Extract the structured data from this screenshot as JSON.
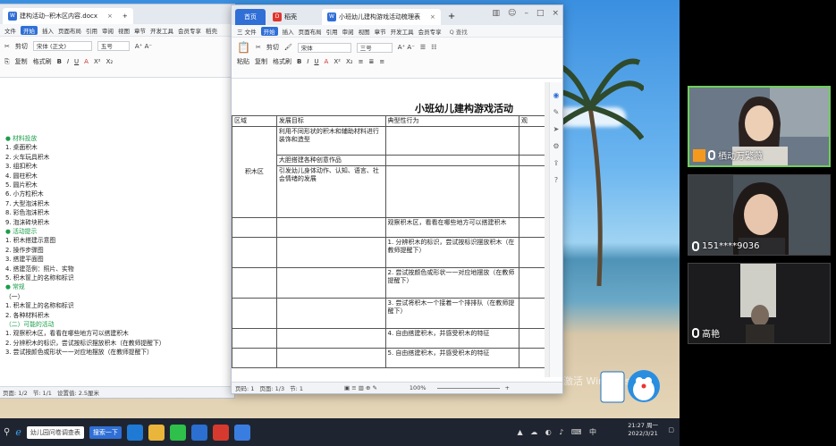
{
  "bg_window": {
    "tab_label": "建构活动--积木区内容.docx",
    "menu": [
      "文件",
      "开始",
      "插入",
      "页面布局",
      "引用",
      "审阅",
      "视图",
      "章节",
      "开发工具",
      "会员专享",
      "稻壳"
    ],
    "clipboard": {
      "cut": "剪切",
      "copy": "复制",
      "paste_format": "格式刷"
    },
    "font_name": "宋体 (正文)",
    "font_size": "五号",
    "lines": [
      {
        "text": "●   材料投放",
        "green": true
      },
      {
        "text": "1.  桌面积木",
        "green": false
      },
      {
        "text": "2.  火车玩具积木",
        "green": false
      },
      {
        "text": "3.  组扣积木",
        "green": false
      },
      {
        "text": "4.  圆柱积木",
        "green": false
      },
      {
        "text": "5.  圆片积木",
        "green": false
      },
      {
        "text": "6.  小方粒积木",
        "green": false
      },
      {
        "text": "7.  大型泡沫积木",
        "green": false
      },
      {
        "text": "8.  彩色泡沫积木",
        "green": false
      },
      {
        "text": "9.  泡沫砖块积木",
        "green": false
      },
      {
        "text": "●   活动提示",
        "green": true
      },
      {
        "text": "1.  积木搭建示意图",
        "green": false
      },
      {
        "text": "2.  操作步骤图",
        "green": false
      },
      {
        "text": "3.  搭建平面图",
        "green": false
      },
      {
        "text": "4.  搭建范例：照片、实物",
        "green": false
      },
      {
        "text": "5.  积木筐上的名称和标识",
        "green": false
      },
      {
        "text": "●   常规",
        "green": true
      },
      {
        "text": "（一）",
        "green": false
      },
      {
        "text": "1.  积木筐上的名称和标识",
        "green": false
      },
      {
        "text": "2.  各种材料积木",
        "green": false
      },
      {
        "text": "（二）可能的活动",
        "green": true
      },
      {
        "text": "1.  观察积木区，看看在哪些地方可以搭建积木",
        "green": false
      },
      {
        "text": "2.  分辨积木的标识，尝试按标识摆放积木（在教师提醒下）",
        "green": false
      },
      {
        "text": "3.  尝试按颜色或形状一一对应地摆放（在教师提醒下）",
        "green": false
      }
    ],
    "status": {
      "page": "页面: 1/2",
      "section": "节: 1/1",
      "setting": "设置值: 2.5厘米"
    }
  },
  "fg_window": {
    "tabs": [
      {
        "label": "首页",
        "icon_color": "#2f6fd6"
      },
      {
        "label": "稻壳",
        "icon_color": "#e0352b"
      },
      {
        "label": "小班幼儿建构游戏活动梳理表",
        "icon_color": "#2f6fd6"
      }
    ],
    "menu": [
      "三 文件",
      "开始",
      "插入",
      "页面布局",
      "引用",
      "审阅",
      "视图",
      "章节",
      "开发工具",
      "会员专享"
    ],
    "search_label": "Q 查找",
    "clipboard": {
      "paste": "粘贴",
      "cut": "剪切",
      "copy": "复制",
      "format": "格式刷"
    },
    "font_name": "宋体",
    "font_size": "三号",
    "doc_title": "小班幼儿建构游戏活动",
    "table_headers": [
      "区域",
      "发展目标",
      "典型性行为",
      "观"
    ],
    "area_name": "积木区",
    "goals": [
      "利用不同形状的积木和辅助材料进行装饰和造型",
      "大胆搭建各种创意作品",
      "引发幼儿身体动作、认知、语言、社会情绪的发展"
    ],
    "behaviors": [
      "观察积木区，看看在哪些地方可以搭建积木",
      "1. 分辨积木的标识，尝试按标识摆放积木（在教师提醒下）",
      "2. 尝试按颜色或形状一一对应地摆放（在教师提醒下）",
      "3. 尝试将积木一个接着一个排排队（在教师提醒下）",
      "4. 自由搭建积木，并感受积木的特征",
      "5. 自由搭建积木，并感受积木的特征"
    ],
    "status": {
      "words": "页码: 1",
      "page": "页面: 1/3",
      "section": "节: 1",
      "zoom": "100%"
    }
  },
  "participants": [
    {
      "name": "栖动万繁薇",
      "icon": "avatar-icon"
    },
    {
      "name": "151****9036",
      "icon": "mic-icon"
    },
    {
      "name": "高艳",
      "icon": "mic-icon"
    }
  ],
  "taskbar": {
    "search_placeholder": "幼儿园问卷调查表",
    "search_button": "搜索一下",
    "time": "21:27 周一",
    "date": "2022/3/21",
    "watermark": "激活 Windows"
  }
}
